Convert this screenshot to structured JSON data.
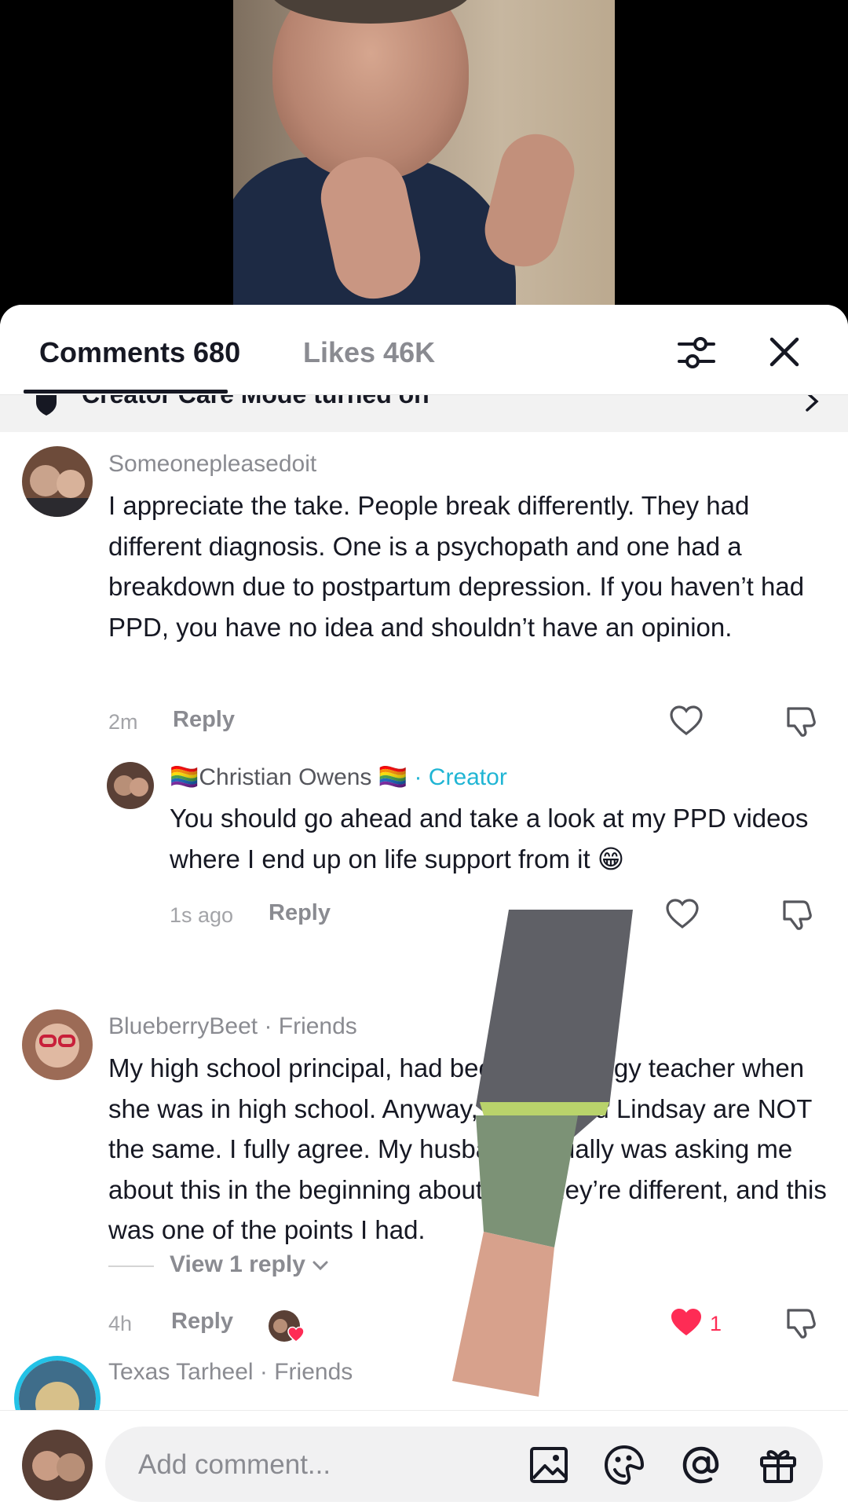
{
  "tabs": {
    "comments_label": "Comments 680",
    "likes_label": "Likes 46K"
  },
  "banner": {
    "text": "Creator Care Mode turned on"
  },
  "comments": [
    {
      "username": "Someonepleasedoit",
      "text": "I appreciate the take. People break differently. They had different diagnosis. One is a psychopath and one had a breakdown due to postpartum depression. If you haven’t had PPD, you have no idea and shouldn’t have an opinion.",
      "time": "2m",
      "reply_label": "Reply",
      "avatar_colors": [
        "#6d4b3a",
        "#c9a38c"
      ]
    },
    {
      "username": "🏳️‍🌈Christian Owens 🏳️‍🌈",
      "tag": " · Creator",
      "text": "You should go ahead and take a look at my PPD videos where I end up on life support from it 😁",
      "time": "1s ago",
      "reply_label": "Reply",
      "avatar_colors": [
        "#5a4036",
        "#b88f77"
      ]
    },
    {
      "username": "BlueberryBeet · Friends",
      "text": "My high school principal, had been her biology teacher when she was in high school. Anyway, Susan and Lindsay are NOT the same. I fully agree. My husband actually was asking me about this in the beginning about why they’re different, and this was one of the points I had.",
      "time": "4h",
      "reply_label": "Reply",
      "like_count": "1",
      "avatar_colors": [
        "#9c6b56",
        "#e0b9a2"
      ]
    },
    {
      "username": "Texas Tarheel · Friends",
      "avatar_colors": [
        "#3f6d8a",
        "#d7c08a"
      ]
    }
  ],
  "view_replies_label": "View 1 reply",
  "composer": {
    "placeholder": "Add comment..."
  },
  "colors": {
    "accent_creator": "#20b5d4",
    "liked_heart": "#fe2c55"
  }
}
